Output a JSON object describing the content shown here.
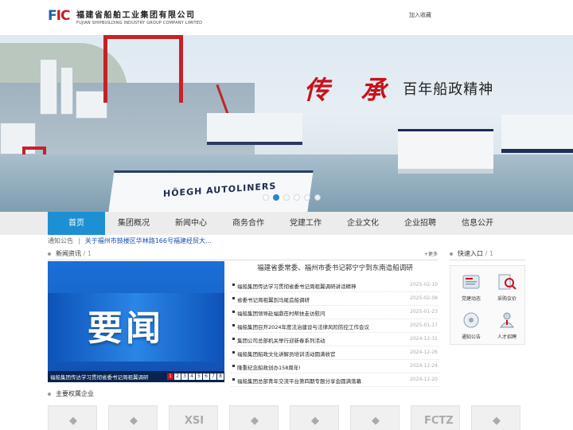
{
  "header": {
    "logo_mark_a": "F",
    "logo_mark_b": "IC",
    "logo_cn": "福建省船舶工业集团有限公司",
    "logo_en": "FUJIAN SHIPBUILDING INDUSTRY GROUP COMPANY LIMITED",
    "favorite": "加入收藏"
  },
  "banner": {
    "slogan_big": "传 承",
    "slogan_small": "百年船政精神",
    "ship_name": "HÖEGH AUTOLINERS",
    "slides": 6,
    "active_slide": 1
  },
  "nav": {
    "items": [
      "首页",
      "集团概况",
      "新闻中心",
      "商务合作",
      "党建工作",
      "企业文化",
      "企业招聘",
      "信息公开"
    ],
    "active": 0
  },
  "notice": {
    "label": "通知公告",
    "text": "关于福州市鼓楼区华林路166号福建经贸大..."
  },
  "news": {
    "title": "新闻资讯",
    "num": "/ 1",
    "more": "+更多",
    "image_text": "要闻",
    "caption": "福船集团传达学习贯彻省委书记周祖翼调研",
    "pager": [
      "1",
      "2",
      "3",
      "4",
      "5",
      "6",
      "7",
      "8"
    ],
    "pager_active": 0,
    "headline": "福建省委常委、福州市委书记郭宁宁到东南造船调研",
    "items": [
      {
        "title": "福船集团传达学习贯彻省委书记周祖翼调研讲话精神",
        "date": "2025-02-10"
      },
      {
        "title": "省委书记周祖翼到马尾造船调研",
        "date": "2025-02-08"
      },
      {
        "title": "福船集团领导赴福鼎茌村帮扶走访慰问",
        "date": "2025-01-23"
      },
      {
        "title": "福船集团召开2024年度法治建设与法律风险防控工作会议",
        "date": "2025-01-17"
      },
      {
        "title": "集团公司总部机关举行迎新春系列活动",
        "date": "2024-12-31"
      },
      {
        "title": "福船集团船政文化讲解员培训活动圆满收官",
        "date": "2024-12-26"
      },
      {
        "title": "隆重纪念船政创办158周年!",
        "date": "2024-12-24"
      },
      {
        "title": "福船集团总部青年交流平台第四期专题分享会圆满落幕",
        "date": "2024-12-20"
      }
    ]
  },
  "quick": {
    "title": "快速入口",
    "num": "/ 1",
    "items": [
      {
        "label": "党建动态",
        "icon": "party-building-icon"
      },
      {
        "label": "采购议价",
        "icon": "procurement-icon"
      },
      {
        "label": "通知公告",
        "icon": "notice-icon"
      },
      {
        "label": "人才招聘",
        "icon": "recruitment-icon"
      }
    ]
  },
  "subs": {
    "title": "主要权属企业",
    "logos": [
      "",
      "",
      "XSI",
      "",
      "",
      "",
      "FCTZ",
      ""
    ]
  },
  "colors": {
    "accent": "#1d8fd3",
    "brand_red": "#c8121a",
    "link": "#1a4fb8"
  }
}
